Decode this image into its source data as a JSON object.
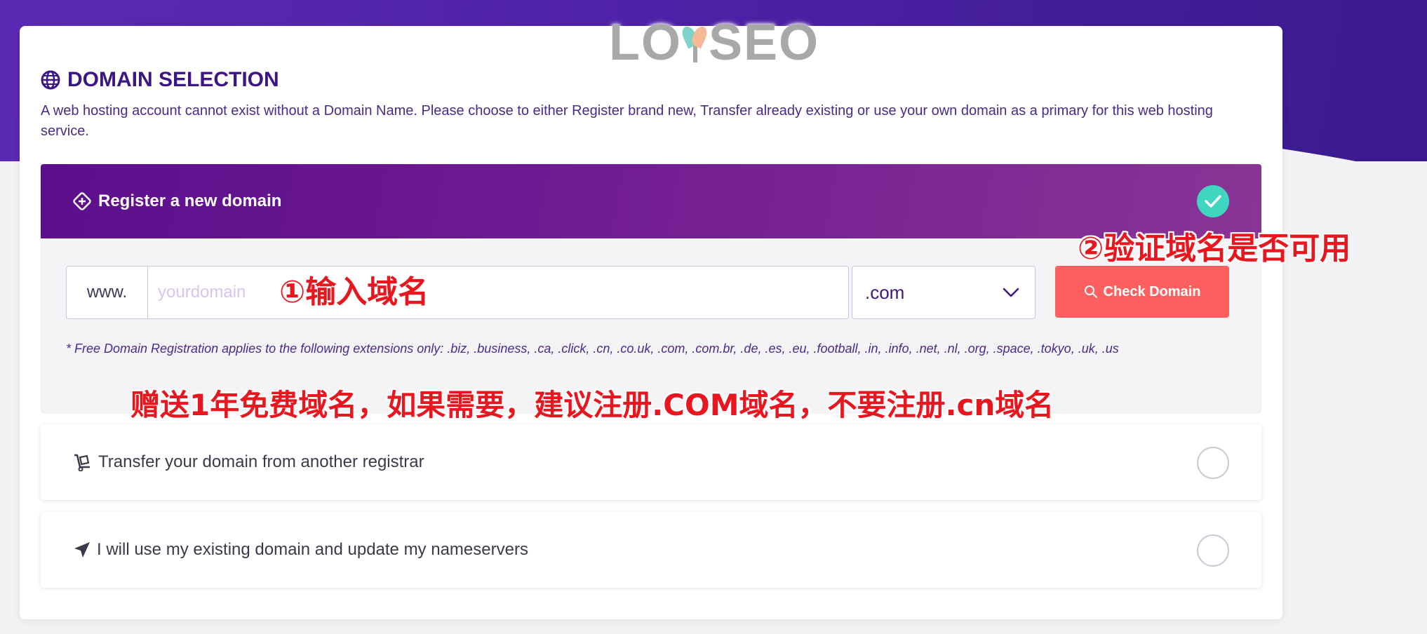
{
  "logo": {
    "text_left": "LO",
    "text_right": "SEO"
  },
  "section": {
    "title": "DOMAIN SELECTION",
    "description": "A web hosting account cannot exist without a Domain Name. Please choose to either Register brand new, Transfer already existing or use your own domain as a primary for this web hosting service."
  },
  "register": {
    "label": "Register a new domain",
    "www_prefix": "www.",
    "input_value": "",
    "input_placeholder": "yourdomain",
    "tld_selected": ".com",
    "check_button": "Check Domain",
    "free_note": "* Free Domain Registration applies to the following extensions only: .biz, .business, .ca, .click, .cn, .co.uk, .com, .com.br, .de, .es, .eu, .football, .in, .info, .net, .nl, .org, .space, .tokyo, .uk, .us"
  },
  "transfer": {
    "label": "Transfer your domain from another registrar"
  },
  "existing": {
    "label": "I will use my existing domain and update my nameservers"
  },
  "annotations": {
    "step1": "①输入域名",
    "step2": "②验证域名是否可用",
    "note": "赠送1年免费域名，如果需要，建议注册.COM域名，不要注册.cn域名"
  },
  "colors": {
    "accent_purple": "#5c0e8c",
    "check_button": "#ff5f5f",
    "selected_check": "#3fd6c0",
    "annotation_red": "#e8161e"
  }
}
